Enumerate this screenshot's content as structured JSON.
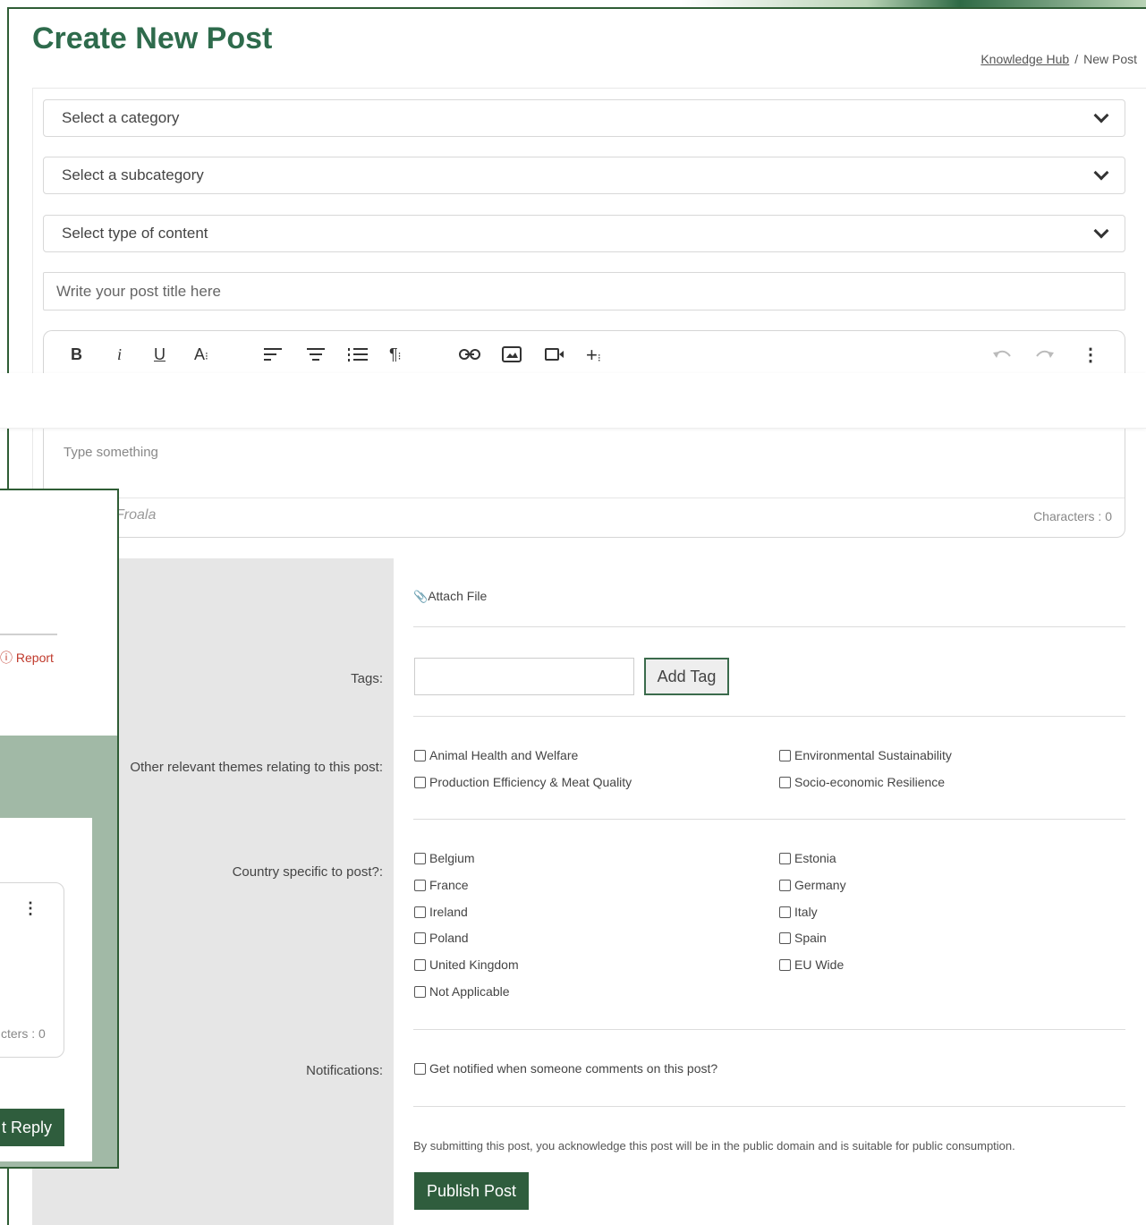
{
  "page": {
    "title": "Create New Post"
  },
  "breadcrumb": {
    "link": "Knowledge Hub",
    "separator": "/",
    "current": "New Post"
  },
  "form": {
    "category_select": "Select a category",
    "subcategory_select": "Select a subcategory",
    "content_type_select": "Select type of content",
    "title_placeholder": "Write your post title here"
  },
  "editor": {
    "toolbar": {
      "bold": "B",
      "italic": "i",
      "underline": "U",
      "font": "A",
      "more_dots": "⋮"
    },
    "placeholder": "Type something",
    "powered_by": "Froala",
    "character_count": "Characters : 0"
  },
  "attachments": {
    "attach_label": "Attach File"
  },
  "tags": {
    "label": "Tags:",
    "input_value": "",
    "add_button": "Add Tag"
  },
  "themes": {
    "label": "Other relevant themes relating to this post:",
    "options": [
      "Animal Health and Welfare",
      "Environmental Sustainability",
      "Production Efficiency & Meat Quality",
      "Socio-economic Resilience"
    ]
  },
  "countries": {
    "label": "Country specific to post?:",
    "options": [
      "Belgium",
      "Estonia",
      "France",
      "Germany",
      "Ireland",
      "Italy",
      "Poland",
      "Spain",
      "United Kingdom",
      "EU Wide",
      "Not Applicable"
    ]
  },
  "notifications": {
    "label": "Notifications:",
    "option": "Get notified when someone comments on this post?"
  },
  "submit": {
    "disclaimer": "By submitting this post, you acknowledge this post will be in the public domain and is suitable for public consumption.",
    "publish_button": "Publish Post"
  },
  "overlay": {
    "report_label": "ⓘ Report",
    "editor_dots": "⋮",
    "character_count": "cters : 0",
    "reply_button": "t Reply"
  },
  "colors": {
    "brand_green": "#2e6b4c",
    "button_green": "#2f5d3d",
    "report_red": "#c0392b"
  }
}
